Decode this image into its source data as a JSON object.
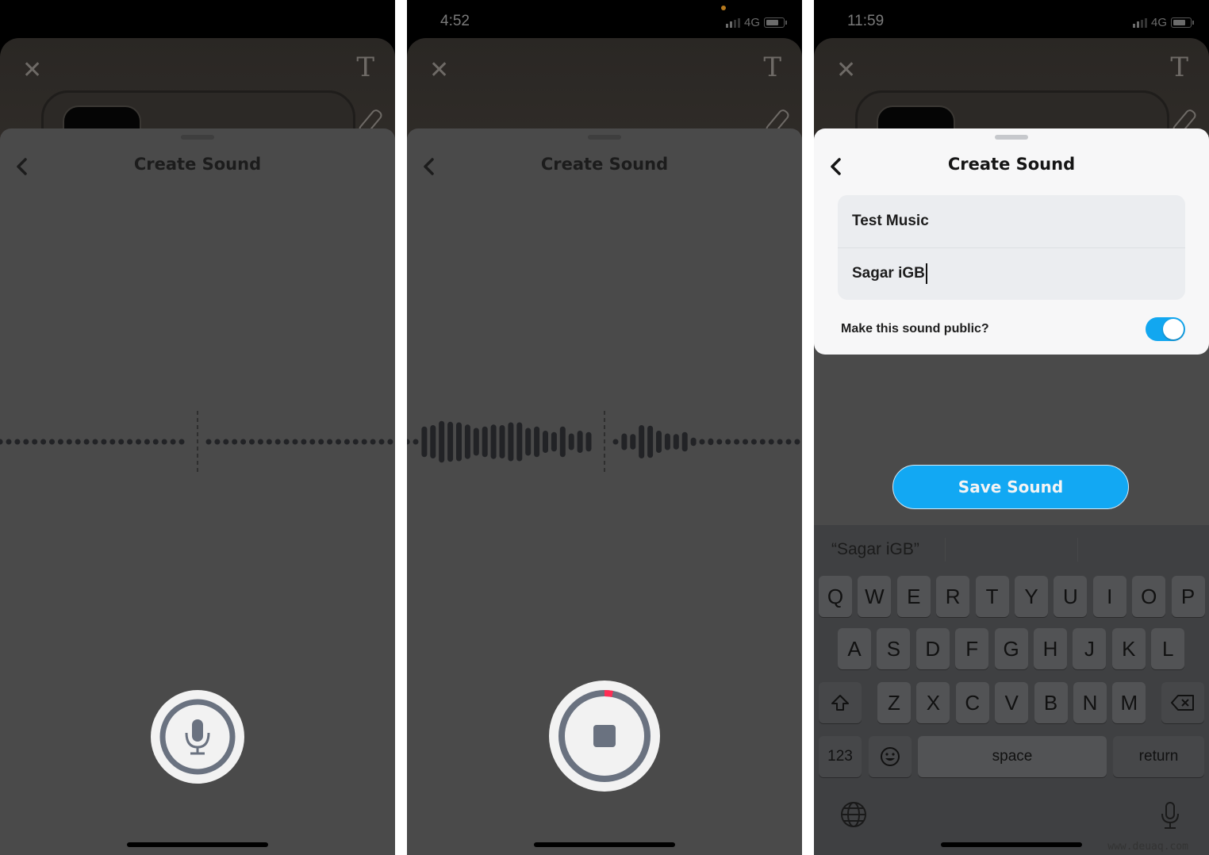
{
  "screens": [
    {
      "id": "idle",
      "status": null,
      "sheet_title": "Create Sound",
      "record_button": {
        "state": "idle",
        "icon": "microphone-icon"
      },
      "waveform": {
        "left_levels": [
          0,
          0,
          0,
          0,
          0,
          0,
          0,
          0,
          0,
          0,
          0,
          0,
          0,
          0,
          0,
          0,
          0,
          0,
          0,
          0,
          0,
          0,
          0
        ],
        "right_levels": [
          0,
          0,
          0,
          0,
          0,
          0,
          0,
          0,
          0,
          0,
          0,
          0,
          0,
          0,
          0,
          0,
          0,
          0,
          0,
          0,
          0,
          0,
          0
        ]
      }
    },
    {
      "id": "recording",
      "status": {
        "time": "4:52",
        "network": "4G",
        "recording_indicator": true
      },
      "sheet_title": "Create Sound",
      "record_button": {
        "state": "recording",
        "icon": "stop-icon",
        "progress": 0.03,
        "progress_color": "#ff2d55"
      },
      "waveform": {
        "left_levels": [
          0,
          0,
          0.55,
          0.6,
          0.75,
          0.72,
          0.7,
          0.62,
          0.5,
          0.55,
          0.62,
          0.6,
          0.7,
          0.7,
          0.5,
          0.55,
          0.4,
          0.35,
          0.55,
          0.3,
          0.4,
          0.35
        ],
        "right_levels": [
          0,
          0.3,
          0.28,
          0.6,
          0.58,
          0.4,
          0.3,
          0.28,
          0.35,
          0.15,
          0,
          0.12,
          0.1,
          0,
          0,
          0,
          0,
          0,
          0,
          0,
          0,
          0
        ]
      }
    },
    {
      "id": "details",
      "status": {
        "time": "11:59",
        "network": "4G",
        "recording_indicator": false
      },
      "sheet_title": "Create Sound",
      "fields": {
        "sound_name": "Test Music",
        "artist_name": "Sagar iGB"
      },
      "public_label": "Make this sound public?",
      "public_enabled": true,
      "save_label": "Save Sound",
      "keyboard": {
        "suggestions": [
          "“Sagar iGB”",
          "",
          ""
        ],
        "row1": [
          "Q",
          "W",
          "E",
          "R",
          "T",
          "Y",
          "U",
          "I",
          "O",
          "P"
        ],
        "row2": [
          "A",
          "S",
          "D",
          "F",
          "G",
          "H",
          "J",
          "K",
          "L"
        ],
        "row3": [
          "Z",
          "X",
          "C",
          "V",
          "B",
          "N",
          "M"
        ],
        "numbers_label": "123",
        "space_label": "space",
        "return_label": "return"
      }
    }
  ],
  "colors": {
    "accent": "#12a8f3",
    "record_progress": "#ff2d55",
    "sheet_bg": "#4a4a4a"
  },
  "watermark": "www.deuaq.com"
}
